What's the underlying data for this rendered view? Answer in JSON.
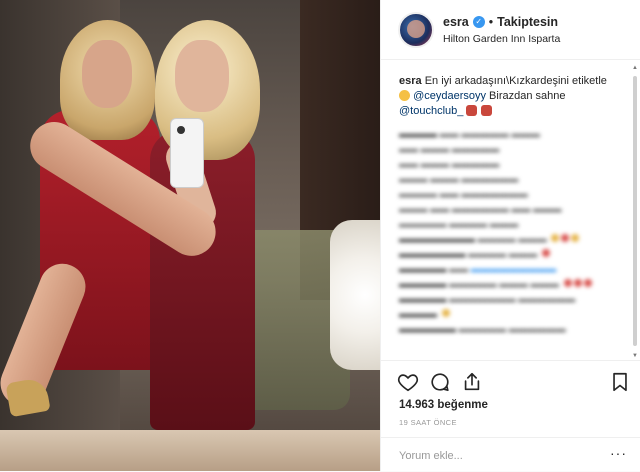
{
  "post": {
    "username": "esra",
    "follow_sep": "•",
    "follow_status": "Takiptesin",
    "location": "Hilton Garden Inn Isparta",
    "caption": {
      "username": "esra",
      "text": "En iyi arkadaşını\\Kızkardeşini etiketle",
      "mention1": "@ceydaersoyy",
      "text2": "Birazdan sahne",
      "mention2": "@touchclub_"
    },
    "likes": "14.963 beğenme",
    "time": "19 SAAT ÖNCE",
    "comment_placeholder": "Yorum ekle...",
    "more_dots": "···"
  },
  "icons": {
    "verified": "verified-badge-icon",
    "like": "heart-icon",
    "comment": "comment-icon",
    "share": "share-icon",
    "save": "bookmark-icon"
  },
  "colors": {
    "link": "#003569",
    "verified": "#3897f0",
    "muted": "#999999"
  }
}
